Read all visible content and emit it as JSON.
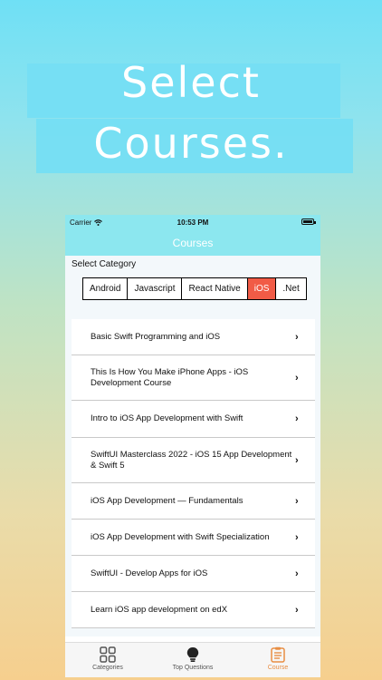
{
  "hero": {
    "line1": "Select",
    "line2": "Courses."
  },
  "status": {
    "carrier": "Carrier",
    "time": "10:53 PM"
  },
  "nav": {
    "title": "Courses"
  },
  "category": {
    "label": "Select Category",
    "options": [
      "Android",
      "Javascript",
      "React Native",
      "iOS",
      ".Net"
    ],
    "selected": "iOS"
  },
  "courses": [
    "Basic Swift Programming and iOS",
    "This Is How You Make iPhone Apps - iOS Development Course",
    "Intro to iOS App Development with Swift",
    "SwiftUI Masterclass 2022 - iOS 15 App Development & Swift 5",
    "iOS App Development — Fundamentals",
    "iOS App Development with Swift Specialization",
    "SwiftUI - Develop Apps for iOS",
    "Learn iOS app development on edX"
  ],
  "tabs": [
    {
      "label": "Categories",
      "icon": "grid-icon"
    },
    {
      "label": "Top Questions",
      "icon": "lightbulb-icon"
    },
    {
      "label": "Course",
      "icon": "course-icon",
      "active": true
    }
  ],
  "colors": {
    "accent": "#f15b46",
    "nav": "#8ce7ef",
    "tabActive": "#e88e44"
  }
}
